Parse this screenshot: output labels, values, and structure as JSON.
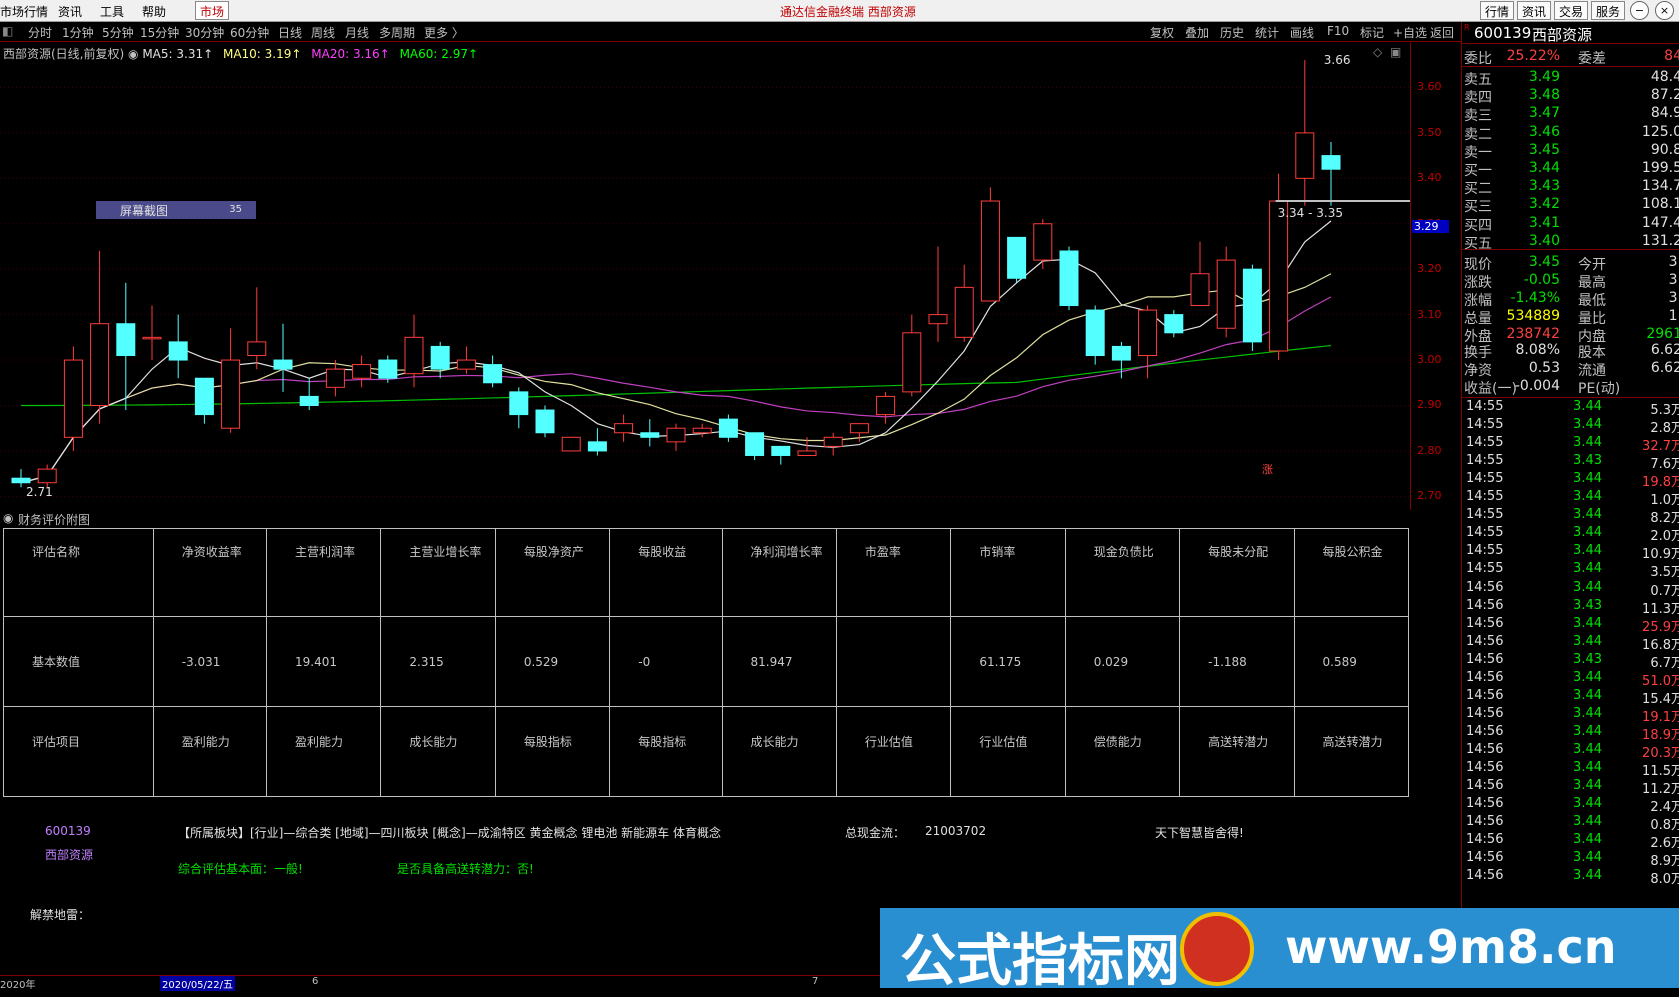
{
  "menubar": {
    "items": [
      "市场行情",
      "资讯",
      "工具",
      "帮助"
    ],
    "market_btn": "市场",
    "title": "通达信金融终端  西部资源",
    "right_buttons": [
      "行情",
      "资讯",
      "交易",
      "服务"
    ]
  },
  "periods": [
    "分时",
    "1分钟",
    "5分钟",
    "15分钟",
    "30分钟",
    "60分钟",
    "日线",
    "周线",
    "月线",
    "多周期",
    "更多 〉"
  ],
  "tools": [
    "复权",
    "叠加",
    "历史",
    "统计",
    "画线",
    "F10",
    "标记",
    "+自选",
    "返回"
  ],
  "chart_header": {
    "name": "西部资源(日线,前复权)",
    "ma5": "MA5: 3.31↑",
    "ma10": "MA10: 3.19↑",
    "ma20": "MA20: 3.16↑",
    "ma60": "MA60: 2.97↑"
  },
  "annotations": {
    "high": "3.66",
    "low": "2.71",
    "range": "3.34 - 3.35",
    "current_price_tag": "3.29",
    "zhang": "涨",
    "screenshot_label": "屏幕截图",
    "screenshot_num": "35"
  },
  "chart_data": {
    "type": "candlestick",
    "price_axis_ticks": [
      "3.60",
      "3.50",
      "3.40",
      "3.30",
      "3.20",
      "3.10",
      "3.00",
      "2.90",
      "2.80",
      "2.70"
    ],
    "ylim": [
      2.67,
      3.7
    ],
    "candles": [
      [
        2.74,
        2.73,
        2.76,
        2.72
      ],
      [
        2.73,
        2.76,
        2.77,
        2.72
      ],
      [
        2.83,
        3.0,
        3.03,
        2.8
      ],
      [
        2.9,
        3.08,
        3.24,
        2.86
      ],
      [
        3.08,
        3.01,
        3.17,
        2.89
      ],
      [
        3.05,
        3.05,
        3.12,
        3.0
      ],
      [
        3.04,
        3.0,
        3.1,
        2.96
      ],
      [
        2.96,
        2.88,
        2.96,
        2.86
      ],
      [
        2.85,
        3.0,
        3.07,
        2.84
      ],
      [
        3.01,
        3.04,
        3.16,
        2.98
      ],
      [
        3.0,
        2.98,
        3.08,
        2.93
      ],
      [
        2.92,
        2.9,
        2.96,
        2.89
      ],
      [
        2.94,
        2.98,
        3.0,
        2.92
      ],
      [
        2.96,
        2.99,
        3.01,
        2.94
      ],
      [
        3.0,
        2.96,
        3.01,
        2.95
      ],
      [
        2.97,
        3.05,
        3.1,
        2.94
      ],
      [
        3.03,
        2.98,
        3.04,
        2.96
      ],
      [
        2.98,
        3.0,
        3.03,
        2.97
      ],
      [
        2.99,
        2.95,
        3.01,
        2.94
      ],
      [
        2.93,
        2.88,
        2.94,
        2.85
      ],
      [
        2.89,
        2.84,
        2.9,
        2.83
      ],
      [
        2.8,
        2.83,
        2.83,
        2.8
      ],
      [
        2.82,
        2.8,
        2.85,
        2.79
      ],
      [
        2.84,
        2.86,
        2.88,
        2.82
      ],
      [
        2.84,
        2.83,
        2.87,
        2.81
      ],
      [
        2.82,
        2.85,
        2.86,
        2.8
      ],
      [
        2.84,
        2.85,
        2.86,
        2.83
      ],
      [
        2.87,
        2.83,
        2.88,
        2.82
      ],
      [
        2.84,
        2.79,
        2.84,
        2.78
      ],
      [
        2.81,
        2.79,
        2.81,
        2.77
      ],
      [
        2.79,
        2.8,
        2.83,
        2.79
      ],
      [
        2.81,
        2.83,
        2.84,
        2.79
      ],
      [
        2.84,
        2.86,
        2.86,
        2.82
      ],
      [
        2.88,
        2.92,
        2.93,
        2.86
      ],
      [
        2.93,
        3.06,
        3.1,
        2.92
      ],
      [
        3.08,
        3.1,
        3.25,
        3.04
      ],
      [
        3.05,
        3.16,
        3.21,
        3.04
      ],
      [
        3.13,
        3.35,
        3.38,
        3.13
      ],
      [
        3.27,
        3.18,
        3.27,
        3.17
      ],
      [
        3.22,
        3.3,
        3.31,
        3.2
      ],
      [
        3.24,
        3.12,
        3.25,
        3.11
      ],
      [
        3.11,
        3.01,
        3.12,
        2.99
      ],
      [
        3.03,
        3.0,
        3.04,
        2.96
      ],
      [
        3.01,
        3.11,
        3.12,
        2.96
      ],
      [
        3.1,
        3.06,
        3.11,
        3.05
      ],
      [
        3.12,
        3.19,
        3.26,
        3.12
      ],
      [
        3.07,
        3.22,
        3.25,
        3.05
      ],
      [
        3.2,
        3.04,
        3.21,
        3.02
      ],
      [
        3.02,
        3.35,
        3.41,
        3.0
      ],
      [
        3.4,
        3.5,
        3.66,
        3.34
      ],
      [
        3.45,
        3.42,
        3.48,
        3.34
      ]
    ]
  },
  "subchart_title": "财务评价附图",
  "fin_table": {
    "headers": [
      "评估名称",
      "净资收益率",
      "主营利润率",
      "主营业增长率",
      "每股净资产",
      "每股收益",
      "净利润增长率",
      "市盈率",
      "市销率",
      "现金负债比",
      "每股未分配",
      "每股公积金"
    ],
    "values": [
      "基本数值",
      "-3.031",
      "19.401",
      "2.315",
      "0.529",
      "-0",
      "81.947",
      "",
      "61.175",
      "0.029",
      "-1.188",
      "0.589"
    ],
    "items": [
      "评估项目",
      "盈利能力",
      "盈利能力",
      "成长能力",
      "每股指标",
      "每股指标",
      "成长能力",
      "行业估值",
      "行业估值",
      "偿债能力",
      "高送转潜力",
      "高送转潜力"
    ]
  },
  "info": {
    "code": "600139",
    "name": "西部资源",
    "sectors": "【所属板块】[行业]—综合类 [地域]—四川板块 [概念]—成渝特区 黄金概念 锂电池 新能源车 体育概念",
    "cash_flow_label": "总现金流：",
    "cash_flow_value": "21003702",
    "slogan": "天下智慧皆舍得!",
    "eval_basic": "综合评估基本面：一般!",
    "eval_high_send": "是否具备高送转潜力：否!",
    "unlock": "解禁地雷："
  },
  "bottombar": {
    "year": "2020年",
    "date": "2020/05/22/五",
    "m6": "6",
    "m7": "7"
  },
  "rightpanel": {
    "code": "600139",
    "name": "西部资源",
    "webi_label": "委比",
    "webi_value": "25.22%",
    "wecha_label": "委差",
    "wecha_value": "84",
    "sells": [
      {
        "label": "卖五",
        "price": "3.49",
        "vol": "48.4"
      },
      {
        "label": "卖四",
        "price": "3.48",
        "vol": "87.2"
      },
      {
        "label": "卖三",
        "price": "3.47",
        "vol": "84.9"
      },
      {
        "label": "卖二",
        "price": "3.46",
        "vol": "125.0"
      },
      {
        "label": "卖一",
        "price": "3.45",
        "vol": "90.8"
      }
    ],
    "buys": [
      {
        "label": "买一",
        "price": "3.44",
        "vol": "199.5"
      },
      {
        "label": "买二",
        "price": "3.43",
        "vol": "134.7"
      },
      {
        "label": "买三",
        "price": "3.42",
        "vol": "108.1"
      },
      {
        "label": "买四",
        "price": "3.41",
        "vol": "147.4"
      },
      {
        "label": "买五",
        "price": "3.40",
        "vol": "131.2"
      }
    ],
    "quote": [
      {
        "l1": "现价",
        "v1": "3.45",
        "c1": "green",
        "l2": "今开",
        "v2": "3."
      },
      {
        "l1": "涨跌",
        "v1": "-0.05",
        "c1": "green",
        "l2": "最高",
        "v2": "3."
      },
      {
        "l1": "涨幅",
        "v1": "-1.43%",
        "c1": "green",
        "l2": "最低",
        "v2": "3."
      },
      {
        "l1": "总量",
        "v1": "534889",
        "c1": "yellow",
        "l2": "量比",
        "v2": "1."
      },
      {
        "l1": "外盘",
        "v1": "238742",
        "c1": "red",
        "l2": "内盘",
        "v2": "2961"
      }
    ],
    "quote2": [
      {
        "l1": "换手",
        "v1": "8.08%",
        "l2": "股本",
        "v2": "6.62"
      },
      {
        "l1": "净资",
        "v1": "0.53",
        "l2": "流通",
        "v2": "6.62"
      },
      {
        "l1": "收益(一)",
        "v1": "-0.004",
        "l2": "PE(动)",
        "v2": ""
      }
    ],
    "ticks": [
      {
        "t": "14:55",
        "p": "3.44",
        "v": "5.3万",
        "c": "white"
      },
      {
        "t": "14:55",
        "p": "3.44",
        "v": "2.8万",
        "c": "white"
      },
      {
        "t": "14:55",
        "p": "3.44",
        "v": "32.7万",
        "c": "red"
      },
      {
        "t": "14:55",
        "p": "3.43",
        "v": "7.6万",
        "c": "white"
      },
      {
        "t": "14:55",
        "p": "3.44",
        "v": "19.8万",
        "c": "red"
      },
      {
        "t": "14:55",
        "p": "3.44",
        "v": "1.0万",
        "c": "white"
      },
      {
        "t": "14:55",
        "p": "3.44",
        "v": "8.2万",
        "c": "white"
      },
      {
        "t": "14:55",
        "p": "3.44",
        "v": "2.0万",
        "c": "white"
      },
      {
        "t": "14:55",
        "p": "3.44",
        "v": "10.9万",
        "c": "white"
      },
      {
        "t": "14:55",
        "p": "3.44",
        "v": "3.5万",
        "c": "white"
      },
      {
        "t": "14:56",
        "p": "3.44",
        "v": "0.7万",
        "c": "white"
      },
      {
        "t": "14:56",
        "p": "3.43",
        "v": "11.3万",
        "c": "white"
      },
      {
        "t": "14:56",
        "p": "3.44",
        "v": "25.9万",
        "c": "red"
      },
      {
        "t": "14:56",
        "p": "3.44",
        "v": "16.8万",
        "c": "white"
      },
      {
        "t": "14:56",
        "p": "3.43",
        "v": "6.7万",
        "c": "white"
      },
      {
        "t": "14:56",
        "p": "3.44",
        "v": "51.0万",
        "c": "red"
      },
      {
        "t": "14:56",
        "p": "3.44",
        "v": "15.4万",
        "c": "white"
      },
      {
        "t": "14:56",
        "p": "3.44",
        "v": "19.1万",
        "c": "red"
      },
      {
        "t": "14:56",
        "p": "3.44",
        "v": "18.9万",
        "c": "red"
      },
      {
        "t": "14:56",
        "p": "3.44",
        "v": "20.3万",
        "c": "red"
      },
      {
        "t": "14:56",
        "p": "3.44",
        "v": "11.5万",
        "c": "white"
      },
      {
        "t": "14:56",
        "p": "3.44",
        "v": "11.2万",
        "c": "white"
      },
      {
        "t": "14:56",
        "p": "3.44",
        "v": "2.4万",
        "c": "white"
      },
      {
        "t": "14:56",
        "p": "3.44",
        "v": "0.8万",
        "c": "white"
      },
      {
        "t": "14:56",
        "p": "3.44",
        "v": "2.6万",
        "c": "white"
      },
      {
        "t": "14:56",
        "p": "3.44",
        "v": "8.9万",
        "c": "white"
      },
      {
        "t": "14:56",
        "p": "3.44",
        "v": "8.0万",
        "c": "white"
      }
    ]
  },
  "watermark": {
    "text": "公式指标网",
    "url": "www.9m8.cn"
  }
}
